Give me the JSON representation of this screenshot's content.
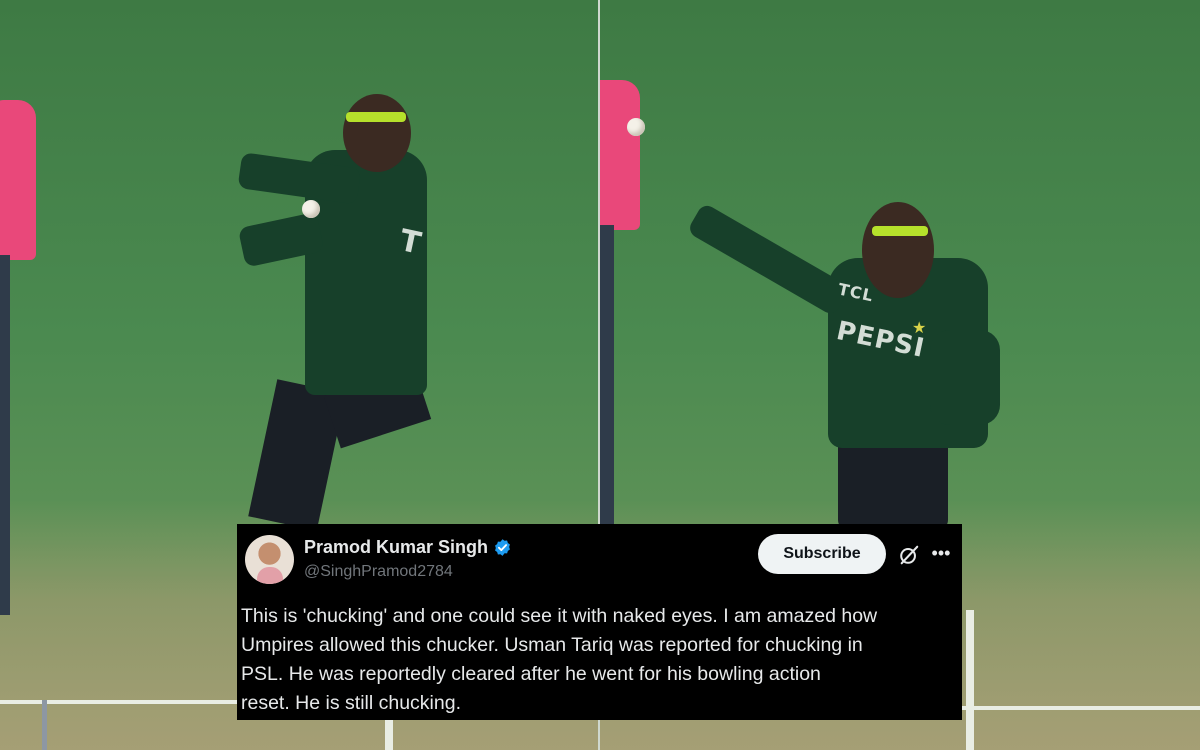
{
  "tweet": {
    "display_name": "Pramod Kumar Singh",
    "handle": "@SinghPramod2784",
    "subscribe_label": "Subscribe",
    "text": "This is 'chucking' and one could see it with naked eyes. I am amazed how\nUmpires allowed this chucker. Usman Tariq was reported for chucking in\nPSL. He was reportedly cleared after he went for  his bowling action\nreset. He is still chucking.",
    "icons": [
      "verified-badge-icon",
      "grok-icon",
      "more-icon"
    ]
  },
  "photo": {
    "right_jersey_brand": "PEPSI",
    "right_jersey_sponsor": "TCL",
    "left_jersey_partial": "T"
  },
  "colors": {
    "card_bg": "#000000",
    "card_text": "#e7e9ea",
    "handle_text": "#71767b",
    "verified": "#1d9bf0",
    "subscribe_bg": "#eff3f4",
    "field_green": "#4b8a50",
    "umpire_pink": "#e9487a",
    "jersey_green": "#17402a"
  }
}
